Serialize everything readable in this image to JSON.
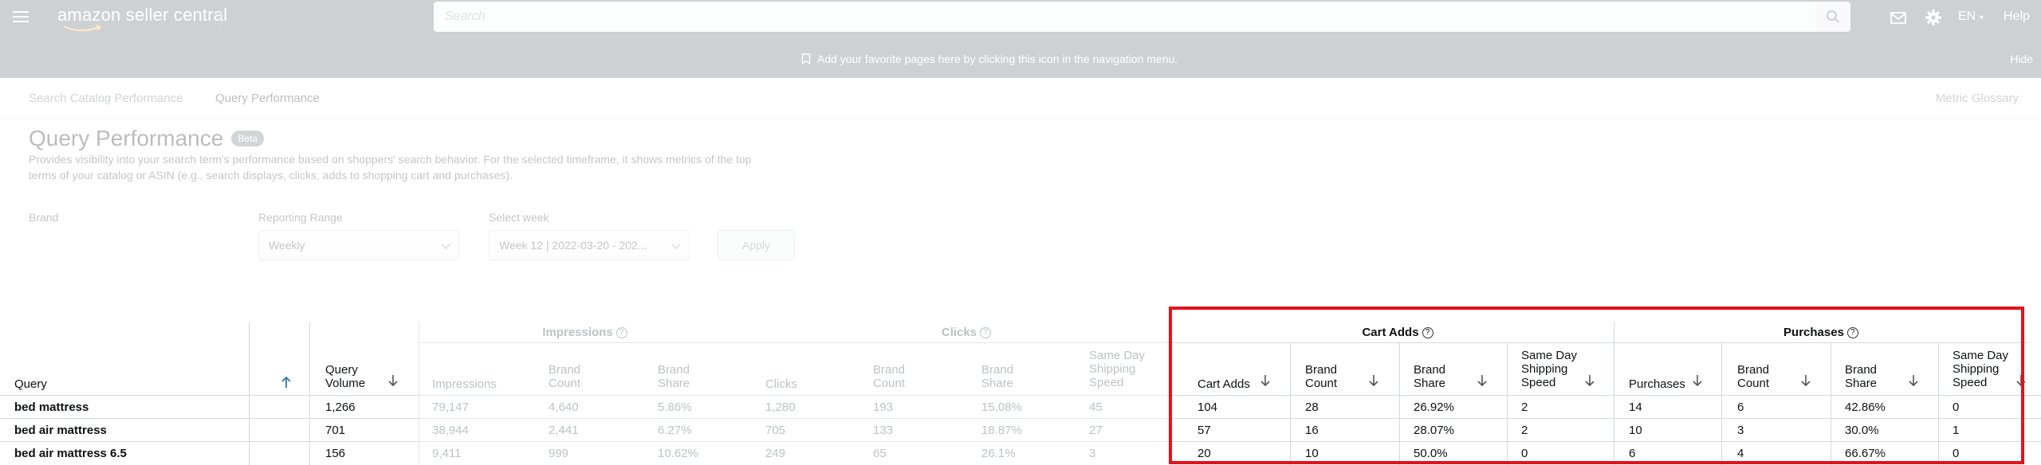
{
  "topbar": {
    "logo_text": "amazon seller central",
    "search_placeholder": "Search",
    "language": "EN",
    "help_label": "Help"
  },
  "bookmark_bar": {
    "message": "Add your favorite pages here by clicking this icon in the navigation menu.",
    "hide_label": "Hide"
  },
  "tabs": [
    {
      "label": "Search Catalog Performance"
    },
    {
      "label": "Query Performance"
    }
  ],
  "glossary_label": "Metric Glossary",
  "page": {
    "title": "Query Performance",
    "badge": "Beta",
    "description": "Provides visibility into your search term's performance based on shoppers' search behavior. For the selected timeframe, it shows metrics of the top terms of your catalog or ASIN (e.g., search displays, clicks, adds to shopping cart and purchases)."
  },
  "filters": {
    "brand_label": "Brand",
    "range_label": "Reporting Range",
    "range_value": "Weekly",
    "week_label": "Select week",
    "week_value": "Week 12 | 2022-03-20 - 202...",
    "apply_label": "Apply"
  },
  "table": {
    "groups": {
      "impressions": "Impressions",
      "clicks": "Clicks",
      "cart_adds": "Cart Adds",
      "purchases": "Purchases"
    },
    "columns": {
      "query": "Query",
      "query_volume": "Query Volume",
      "impressions": "Impressions",
      "brand_count": "Brand Count",
      "brand_share": "Brand Share",
      "clicks": "Clicks",
      "same_day": "Same Day Shipping Speed",
      "cart_adds": "Cart Adds",
      "purchases": "Purchases"
    },
    "rows": [
      {
        "query": "bed mattress",
        "volume": "1,266",
        "imp": "79,147",
        "imp_bc": "4,640",
        "imp_bs": "5.86%",
        "clk": "1,280",
        "clk_bc": "193",
        "clk_bs": "15.08%",
        "clk_sd": "45",
        "ca": "104",
        "ca_bc": "28",
        "ca_bs": "26.92%",
        "ca_sd": "2",
        "pur": "14",
        "pur_bc": "6",
        "pur_bs": "42.86%",
        "pur_sd": "0"
      },
      {
        "query": "bed air mattress",
        "volume": "701",
        "imp": "38,944",
        "imp_bc": "2,441",
        "imp_bs": "6.27%",
        "clk": "705",
        "clk_bc": "133",
        "clk_bs": "18.87%",
        "clk_sd": "27",
        "ca": "57",
        "ca_bc": "16",
        "ca_bs": "28.07%",
        "ca_sd": "2",
        "pur": "10",
        "pur_bc": "3",
        "pur_bs": "30.0%",
        "pur_sd": "1"
      },
      {
        "query": "bed air mattress 6.5",
        "volume": "156",
        "imp": "9,411",
        "imp_bc": "999",
        "imp_bs": "10.62%",
        "clk": "249",
        "clk_bc": "65",
        "clk_bs": "26.1%",
        "clk_sd": "3",
        "ca": "20",
        "ca_bc": "10",
        "ca_bs": "50.0%",
        "ca_sd": "0",
        "pur": "6",
        "pur_bc": "4",
        "pur_bs": "66.67%",
        "pur_sd": "0"
      }
    ]
  },
  "colors": {
    "nav_bg": "#232f3e",
    "highlight": "#e3131a"
  }
}
